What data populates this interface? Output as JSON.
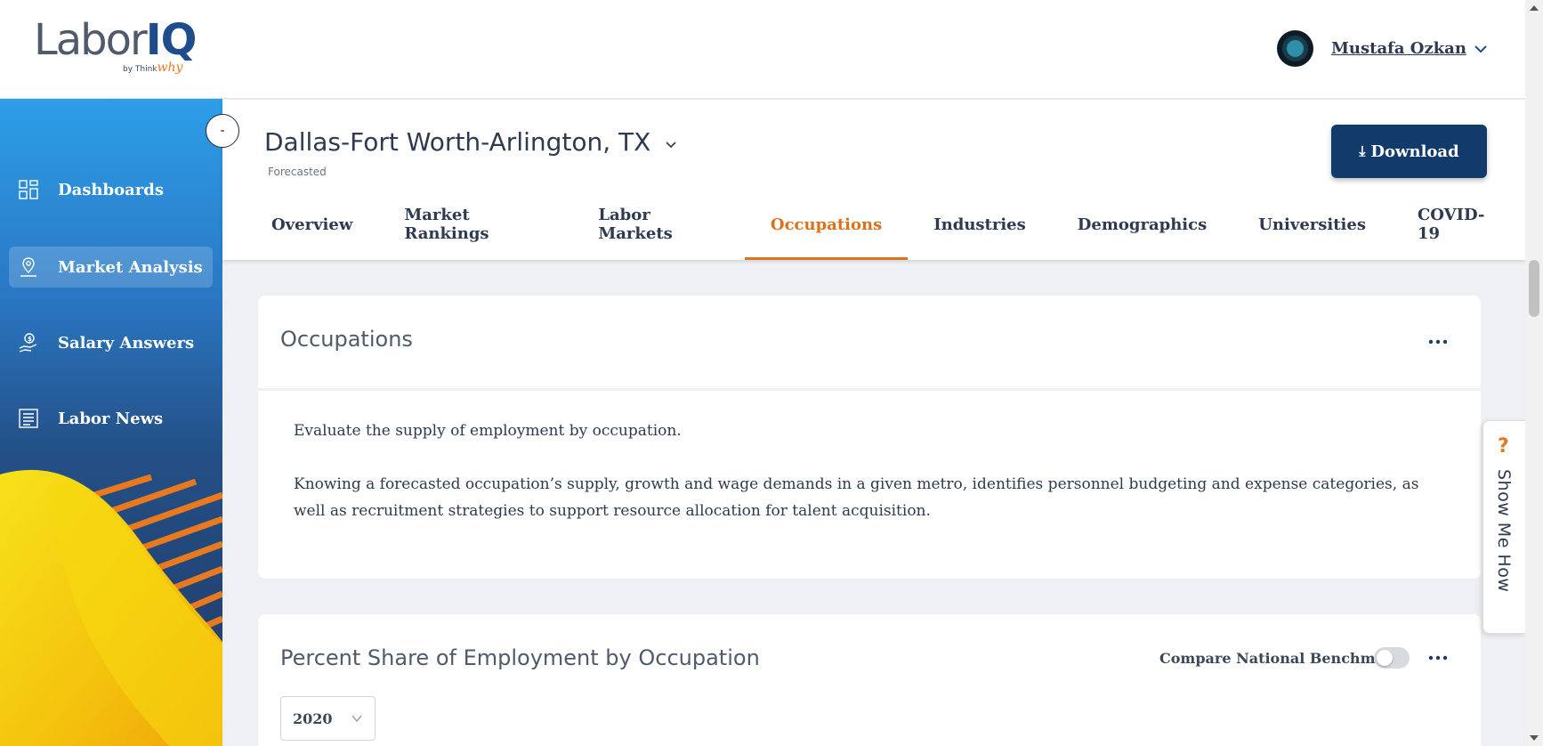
{
  "app": {
    "logo_text": "Labor",
    "logo_text_accent": "IQ",
    "logo_sub_by": "by",
    "logo_sub_think": "Think",
    "logo_sub_why": "why",
    "brand_color": "#123b6b",
    "accent_color": "#e0711c"
  },
  "user": {
    "name": "Mustafa Ozkan",
    "avatar_icon": "fingerprint-avatar",
    "menu_icon": "chevron-down-icon"
  },
  "sidebar": {
    "collapse_label": "-",
    "items": [
      {
        "label": "Dashboards",
        "icon": "grid-icon",
        "active": false
      },
      {
        "label": "Market Analysis",
        "icon": "map-pin-icon",
        "active": true
      },
      {
        "label": "Salary Answers",
        "icon": "salary-hand-icon",
        "active": false
      },
      {
        "label": "Labor News",
        "icon": "news-icon",
        "active": false
      }
    ]
  },
  "header": {
    "metro": "Dallas-Fort Worth-Arlington, TX",
    "metro_sub": "Forecasted",
    "download_label": "Download",
    "download_icon": "download-icon"
  },
  "tabs": [
    {
      "label": "Overview",
      "active": false
    },
    {
      "label": "Market Rankings",
      "active": false
    },
    {
      "label": "Labor Markets",
      "active": false
    },
    {
      "label": "Occupations",
      "active": true
    },
    {
      "label": "Industries",
      "active": false
    },
    {
      "label": "Demographics",
      "active": false
    },
    {
      "label": "Universities",
      "active": false
    },
    {
      "label": "COVID-19",
      "active": false
    }
  ],
  "intro_card": {
    "title": "Occupations",
    "paragraph1": "Evaluate the supply of employment by occupation.",
    "paragraph2": "Knowing a forecasted occupation’s supply, growth and wage demands in a given metro, identifies personnel budgeting and expense categories, as well as recruitment strategies to support resource allocation for talent acquisition."
  },
  "share_card": {
    "title": "Percent Share of Employment by Occupation",
    "benchmark_label": "Compare National Benchmark",
    "benchmark_on": false,
    "year_selected": "2020"
  },
  "help": {
    "icon": "?",
    "label": "Show Me How"
  }
}
